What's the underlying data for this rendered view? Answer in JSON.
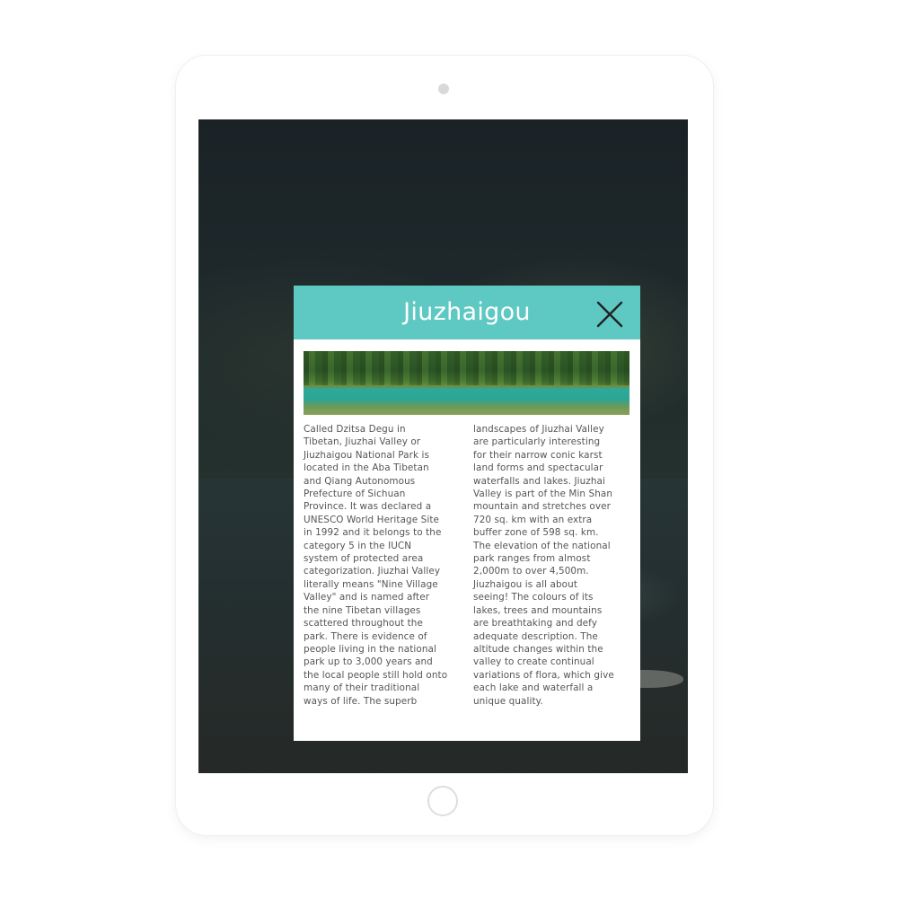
{
  "modal": {
    "title": "Jiuzhaigou",
    "close_icon": "close-icon",
    "image_alt": "lake-landscape",
    "text_left": "   Called Dzitsa Degu in\nTibetan, Jiuzhai Valley or\nJiuzhaigou National Park is\nlocated in the Aba Tibetan\nand Qiang Autonomous\nPrefecture of Sichuan\nProvince. It was declared a\nUNESCO World Heritage Site\nin 1992 and it belongs to the\ncategory 5 in the IUCN\nsystem of protected area\ncategorization. Jiuzhai Valley\nliterally means \"Nine Village\nValley\" and is named after\nthe nine Tibetan villages\nscattered throughout the\npark. There is evidence of\npeople living in the national\npark up to 3,000 years and\nthe local people still hold onto\nmany of their traditional\nways of life. The superb",
    "text_right": "landscapes of Jiuzhai Valley\nare particularly interesting\nfor their narrow conic karst\nland forms and spectacular\nwaterfalls and lakes. Jiuzhai\nValley is part of the Min Shan\nmountain and stretches over\n720 sq. km with an extra\nbuffer zone of 598 sq. km.\nThe elevation of the national\npark ranges from almost\n2,000m to over 4,500m.\nJiuzhaigou is all about\nseeing! The colours of its\nlakes, trees and mountains\nare breathtaking and defy\nadequate description. The\naltitude changes within the\nvalley to create continual\nvariations of flora, which give\neach lake and waterfall a\nunique quality."
  },
  "colors": {
    "header": "#5ec8c2",
    "title_text": "#ffffff",
    "body_text": "#555555",
    "close_icon": "#222222"
  }
}
